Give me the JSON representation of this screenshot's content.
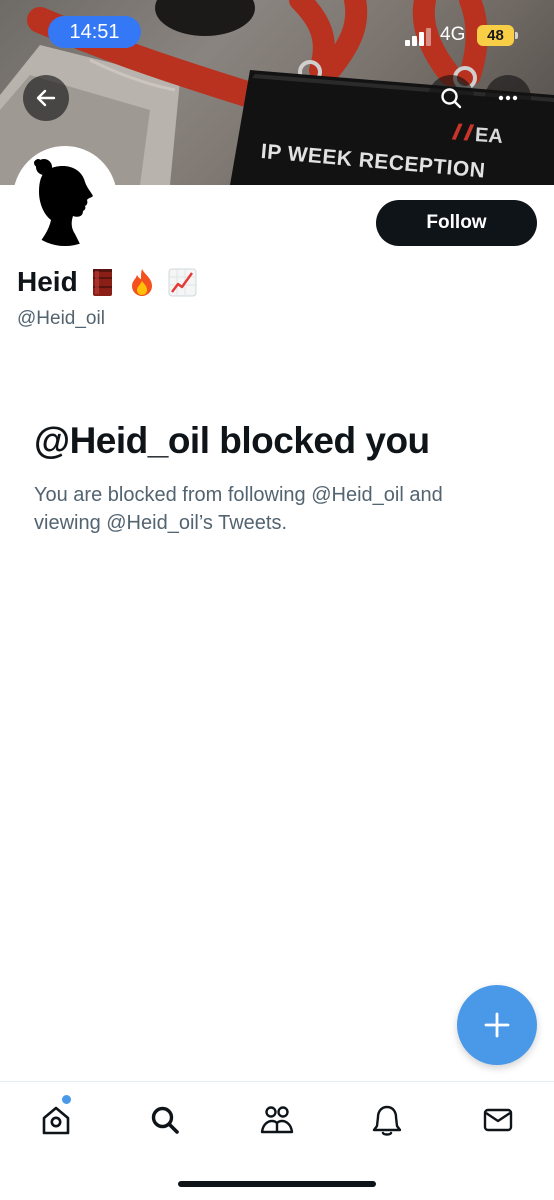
{
  "status_bar": {
    "time": "14:51",
    "network": "4G",
    "battery": "48"
  },
  "banner": {
    "badge_text": "IP WEEK RECEPTION",
    "badge_logo": "EA",
    "lanyard_text": "A"
  },
  "header": {
    "back_icon": "arrow-left-icon",
    "search_icon": "search-icon",
    "more_icon": "more-horizontal-icon"
  },
  "profile": {
    "display_name": "Heid",
    "name_emojis": [
      "oil-drum-emoji",
      "fire-emoji",
      "chart-increasing-emoji"
    ],
    "handle": "@Heid_oil",
    "follow_label": "Follow"
  },
  "blocked": {
    "title": "@Heid_oil blocked you",
    "description": "You are blocked from following @Heid_oil and viewing @Heid_oil’s Tweets."
  },
  "tabbar": {
    "tabs": [
      "home-icon",
      "search-icon",
      "communities-icon",
      "notifications-icon",
      "messages-icon"
    ],
    "unread_dot": true
  },
  "colors": {
    "accent": "#4a99e9",
    "text_primary": "#0f1419",
    "text_secondary": "#536471",
    "status_time_pill": "#3478f6",
    "battery": "#f7ce46"
  }
}
